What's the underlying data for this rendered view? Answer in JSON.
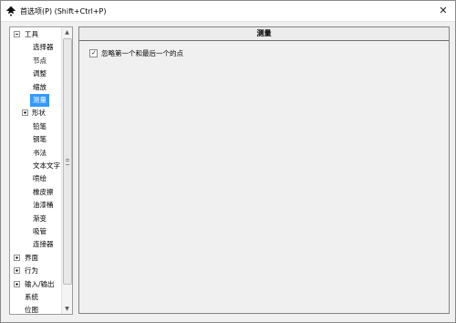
{
  "window": {
    "title": "首选项(P) (Shift+Ctrl+P)",
    "close_glyph": "✕"
  },
  "icons": {
    "app": "inkscape-app-icon",
    "close": "close-icon",
    "expand": "expand-icon",
    "collapse": "collapse-icon"
  },
  "sidebar": {
    "items": [
      {
        "label": "工具",
        "level": 0,
        "expander": "minus"
      },
      {
        "label": "选择器",
        "level": 1
      },
      {
        "label": "节点",
        "level": 1
      },
      {
        "label": "调整",
        "level": 1
      },
      {
        "label": "缩放",
        "level": 1
      },
      {
        "label": "测量",
        "level": 1,
        "selected": true
      },
      {
        "label": "形状",
        "level": 1,
        "expander": "plus"
      },
      {
        "label": "铅笔",
        "level": 1
      },
      {
        "label": "钢笔",
        "level": 1
      },
      {
        "label": "书法",
        "level": 1
      },
      {
        "label": "文本文字",
        "level": 1
      },
      {
        "label": "喷绘",
        "level": 1
      },
      {
        "label": "橡皮擦",
        "level": 1
      },
      {
        "label": "油漆桶",
        "level": 1
      },
      {
        "label": "渐变",
        "level": 1
      },
      {
        "label": "吸管",
        "level": 1
      },
      {
        "label": "连接器",
        "level": 1
      },
      {
        "label": "界面",
        "level": 0,
        "expander": "plus"
      },
      {
        "label": "行为",
        "level": 0,
        "expander": "plus"
      },
      {
        "label": "输入/输出",
        "level": 0,
        "expander": "plus"
      },
      {
        "label": "系统",
        "level": 0
      },
      {
        "label": "位图",
        "level": 0
      }
    ],
    "scroll_up": "▲",
    "scroll_down": "▼"
  },
  "panel": {
    "title": "测量",
    "checkbox": {
      "label": "忽略第一个和最后一个的点",
      "checked": true,
      "mark": "✓"
    }
  },
  "colors": {
    "selection": "#3399ff",
    "selection_text": "#ffffff",
    "window_bg": "#f0f0f0"
  }
}
